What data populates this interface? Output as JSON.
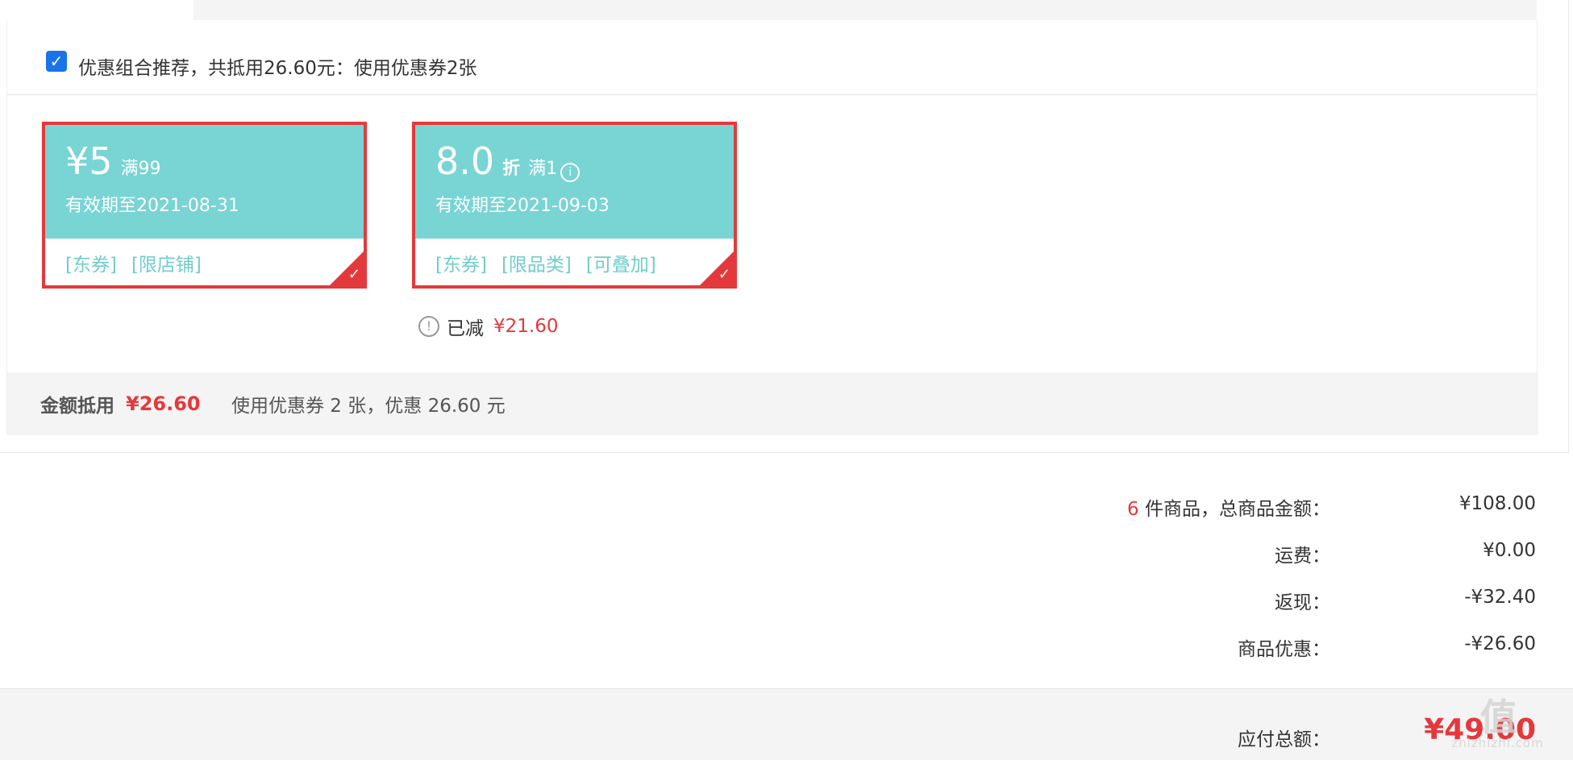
{
  "recommendation": {
    "checked": true,
    "text": "优惠组合推荐，共抵用26.60元：使用优惠券2张"
  },
  "coupons": [
    {
      "amount": "¥5",
      "unit": "",
      "condition": "满99",
      "expire": "有效期至2021-08-31",
      "tags": [
        "[东券]",
        "[限店铺]"
      ],
      "selected": true
    },
    {
      "amount": "8.0",
      "unit": "折",
      "condition": "满1",
      "expire": "有效期至2021-09-03",
      "tags": [
        "[东券]",
        "[限品类]",
        "[可叠加]"
      ],
      "selected": true
    }
  ],
  "applied": {
    "label": "已减",
    "amount": "¥21.60"
  },
  "summary": {
    "label": "金额抵用",
    "amount": "¥26.60",
    "desc": "使用优惠券 2 张，优惠 26.60 元"
  },
  "totals": {
    "item_count": "6",
    "items_label": " 件商品，总商品金额：",
    "items_value": "¥108.00",
    "shipping_label": "运费：",
    "shipping_value": "¥0.00",
    "cashback_label": "返现：",
    "cashback_value": "-¥32.40",
    "discount_label": "商品优惠：",
    "discount_value": "-¥26.60",
    "payable_label": "应付总额：",
    "payable_value": "¥49.00"
  },
  "watermark": {
    "logo": "值",
    "text": "zhizhizhi.com"
  },
  "colors": {
    "accent_red": "#e4393c",
    "coupon_teal": "#79d4d4",
    "tag_teal": "#72cccc",
    "checkbox_blue": "#1a73e8"
  }
}
